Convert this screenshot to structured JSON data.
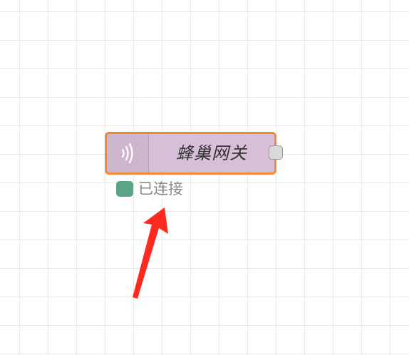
{
  "node": {
    "label": "蜂巢网关",
    "icon": "broadcast-waves-icon",
    "fill_color": "#d8bfd8",
    "selected_border_color": "#f08a3a"
  },
  "status": {
    "text": "已连接",
    "indicator_color": "#5aa586"
  },
  "annotation": {
    "icon": "red-arrow-icon",
    "color": "#ff2a1f"
  }
}
